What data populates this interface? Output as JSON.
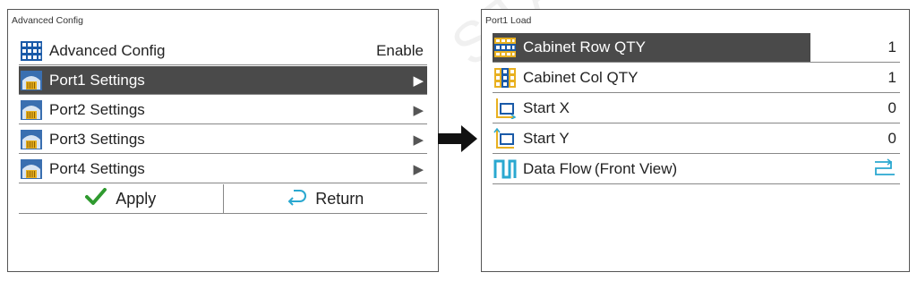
{
  "left_panel": {
    "title": "Advanced Config",
    "items": [
      {
        "label": "Advanced Config",
        "value": "Enable",
        "icon": "grid-icon"
      },
      {
        "label": "Port1 Settings",
        "arrow": "▶",
        "icon": "port-icon",
        "selected": true
      },
      {
        "label": "Port2 Settings",
        "arrow": "▶",
        "icon": "port-icon"
      },
      {
        "label": "Port3 Settings",
        "arrow": "▶",
        "icon": "port-icon"
      },
      {
        "label": "Port4 Settings",
        "arrow": "▶",
        "icon": "port-icon"
      }
    ],
    "buttons": {
      "apply_label": "Apply",
      "return_label": "Return"
    }
  },
  "right_panel": {
    "title": "Port1 Load",
    "items": [
      {
        "label": "Cabinet Row QTY",
        "value": "1",
        "icon": "cabinet-row-icon",
        "selected": true
      },
      {
        "label": "Cabinet Col QTY",
        "value": "1",
        "icon": "cabinet-col-icon"
      },
      {
        "label": "Start  X",
        "value": "0",
        "icon": "start-x-icon"
      },
      {
        "label": "Start  Y",
        "value": "0",
        "icon": "start-y-icon"
      },
      {
        "label": "Data Flow (Front View)",
        "icon": "data-flow-icon"
      }
    ]
  },
  "watermark": "STAR TECH CO.,LTD",
  "colors": {
    "selected_bg": "#4a4a4a",
    "icon_blue": "#1a5aa8",
    "icon_gold": "#e8b020",
    "apply_green": "#2f9a2f",
    "return_cyan": "#2aa8d0"
  }
}
